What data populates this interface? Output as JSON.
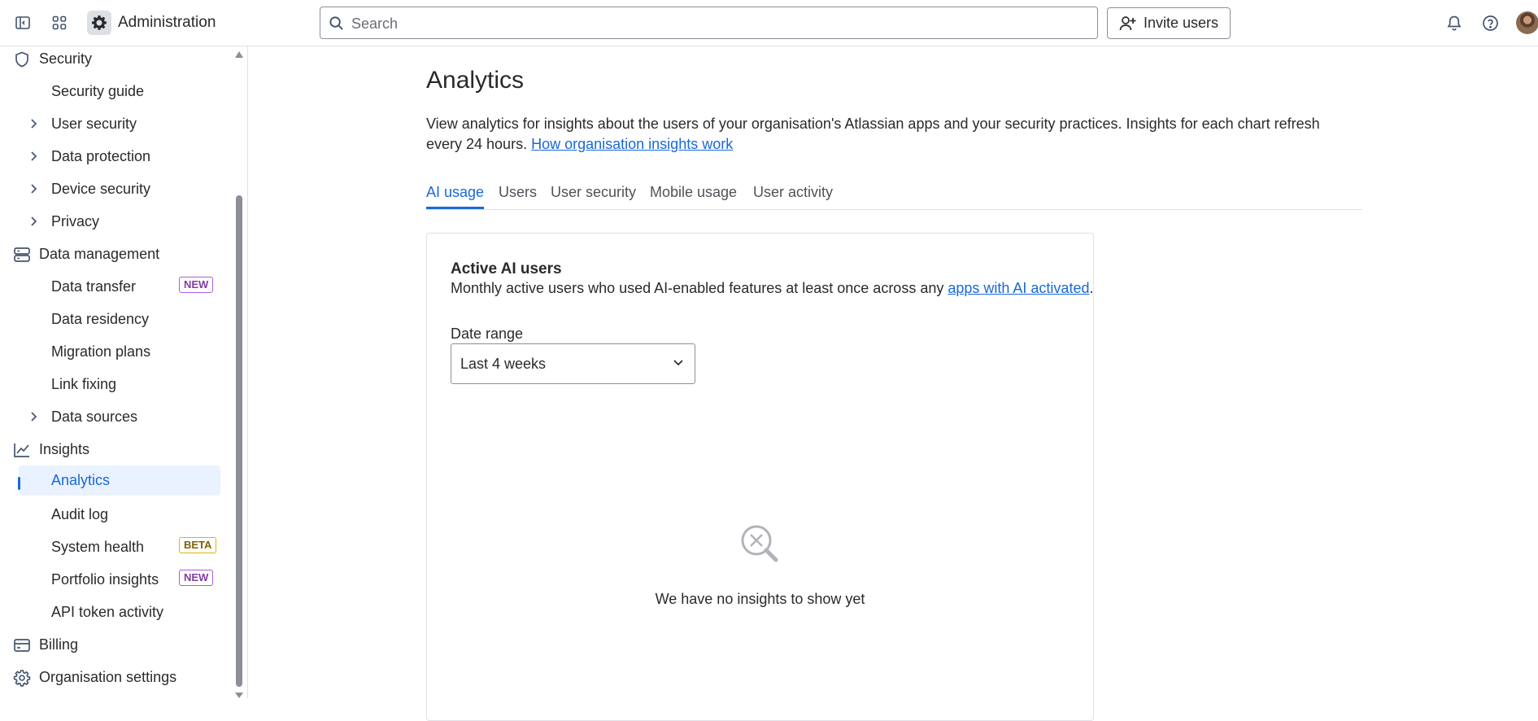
{
  "header": {
    "app_name": "Administration",
    "search_placeholder": "Search",
    "invite_label": "Invite users"
  },
  "sidebar": {
    "items": [
      {
        "label": "Security",
        "level": "top",
        "icon": "shield-icon"
      },
      {
        "label": "Security guide",
        "level": "sub"
      },
      {
        "label": "User security",
        "level": "sub",
        "expandable": true
      },
      {
        "label": "Data protection",
        "level": "sub",
        "expandable": true
      },
      {
        "label": "Device security",
        "level": "sub",
        "expandable": true
      },
      {
        "label": "Privacy",
        "level": "sub",
        "expandable": true
      },
      {
        "label": "Data management",
        "level": "top",
        "icon": "database-icon"
      },
      {
        "label": "Data transfer",
        "level": "sub",
        "badge": "NEW"
      },
      {
        "label": "Data residency",
        "level": "sub"
      },
      {
        "label": "Migration plans",
        "level": "sub"
      },
      {
        "label": "Link fixing",
        "level": "sub"
      },
      {
        "label": "Data sources",
        "level": "sub",
        "expandable": true
      },
      {
        "label": "Insights",
        "level": "top",
        "icon": "line-chart-icon"
      },
      {
        "label": "Analytics",
        "level": "sub",
        "selected": true
      },
      {
        "label": "Audit log",
        "level": "sub"
      },
      {
        "label": "System health",
        "level": "sub",
        "badge": "BETA"
      },
      {
        "label": "Portfolio insights",
        "level": "sub",
        "badge": "NEW"
      },
      {
        "label": "API token activity",
        "level": "sub"
      },
      {
        "label": "Billing",
        "level": "top",
        "icon": "credit-card-icon"
      },
      {
        "label": "Organisation settings",
        "level": "top",
        "icon": "gear-icon"
      }
    ]
  },
  "main": {
    "title": "Analytics",
    "description": "View analytics for insights about the users of your organisation's Atlassian apps and your security practices. Insights for each chart refresh every 24 hours.",
    "description_link": "How organisation insights work",
    "tabs": [
      "AI usage",
      "Users",
      "User security",
      "Mobile usage",
      "User activity"
    ],
    "active_tab": "AI usage",
    "card": {
      "title": "Active AI users",
      "description": "Monthly active users who used AI-enabled features at least once across any",
      "description_link": "apps with AI activated",
      "description_end": ".",
      "date_range_label": "Date range",
      "date_range_value": "Last 4 weeks",
      "empty_state": "We have no insights to show yet"
    }
  },
  "colors": {
    "accent": "#1868db",
    "selected_bg": "#e9f2fe",
    "border": "#dfe1e6",
    "badge_new": "#af59e1",
    "badge_beta": "#e2b203"
  }
}
